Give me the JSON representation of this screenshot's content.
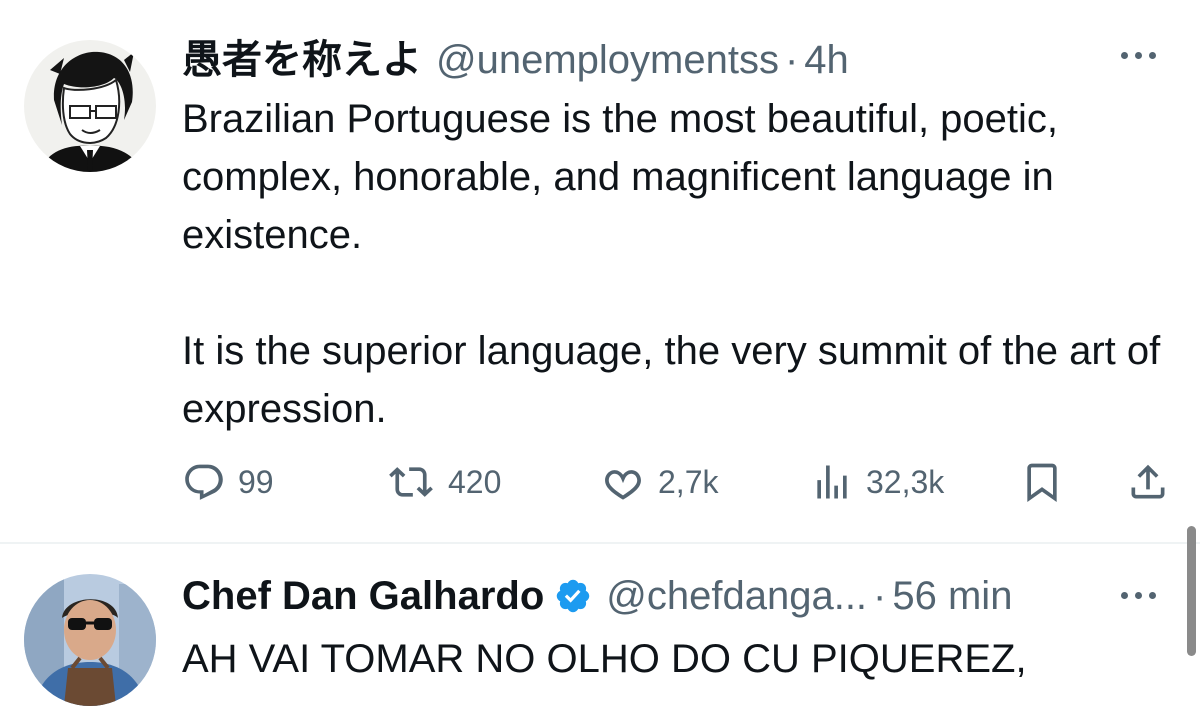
{
  "tweets": [
    {
      "display_name": "愚者を称えよ",
      "handle": "@unemploymentss",
      "separator": "·",
      "time": "4h",
      "paragraphs": [
        "Brazilian Portuguese is the most beautiful, poetic, complex, honorable, and magnificent language in existence.",
        "It is the superior language, the very summit of the art of expression."
      ],
      "actions": {
        "replies": "99",
        "retweets": "420",
        "likes": "2,7k",
        "views": "32,3k"
      }
    },
    {
      "display_name": "Chef Dan Galhardo",
      "verified": true,
      "handle": "@chefdanga...",
      "separator": "·",
      "time": "56 min",
      "paragraphs": [
        "AH VAI TOMAR NO OLHO DO CU PIQUEREZ,"
      ]
    }
  ],
  "colors": {
    "text": "#0f1419",
    "secondary": "#536471",
    "verified_blue": "#1d9bf0",
    "divider": "#eff3f4"
  },
  "icons": [
    "reply-icon",
    "retweet-icon",
    "like-icon",
    "views-icon",
    "bookmark-icon",
    "share-icon",
    "more-icon",
    "verified-badge-icon"
  ]
}
